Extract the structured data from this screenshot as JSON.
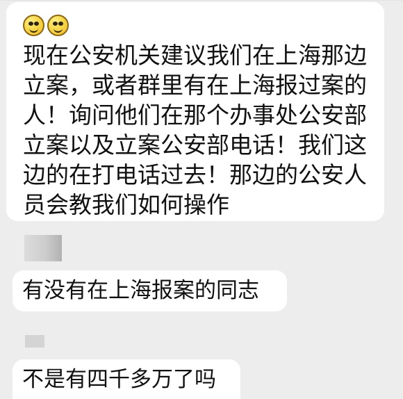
{
  "messages": [
    {
      "id": "main",
      "emoji": [
        "smiling-face-icon",
        "smiling-face-icon"
      ],
      "text": "现在公安机关建议我们在上海那边立案，或者群里有在上海报过案的人！询问他们在那个办事处公安部立案以及立案公安部电话！我们这边的在打电话过去！那边的公安人员会教我们如何操作"
    },
    {
      "id": "reply-1",
      "text": "有没有在上海报案的同志"
    },
    {
      "id": "reply-2",
      "text": "不是有四千多万了吗"
    }
  ]
}
